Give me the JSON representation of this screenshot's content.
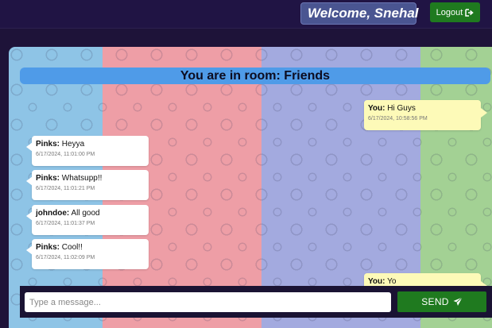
{
  "header": {
    "welcome_text": "Welcome, Snehal",
    "logout_label": "Logout"
  },
  "room": {
    "title": "You are in room: Friends"
  },
  "messages": [
    {
      "sender": "You:",
      "text": "Hi Guys",
      "time": "6/17/2024, 10:58:56 PM",
      "direction": "out"
    },
    {
      "sender": "Pinks:",
      "text": "Heyya",
      "time": "6/17/2024, 11:01:00 PM",
      "direction": "in"
    },
    {
      "sender": "Pinks:",
      "text": "Whatsupp!!",
      "time": "6/17/2024, 11:01:21 PM",
      "direction": "in"
    },
    {
      "sender": "johndoe:",
      "text": "All good",
      "time": "6/17/2024, 11:01:37 PM",
      "direction": "in"
    },
    {
      "sender": "Pinks:",
      "text": "Cool!!",
      "time": "6/17/2024, 11:02:09 PM",
      "direction": "in"
    },
    {
      "sender": "You:",
      "text": "Yo",
      "time": "",
      "direction": "out"
    }
  ],
  "composer": {
    "placeholder": "Type a message...",
    "send_label": "SEND"
  },
  "colors": {
    "background": "#1e1339",
    "accent_green": "#1f7a1f",
    "room_header": "#4f9be8",
    "incoming_bubble": "#ffffff",
    "outgoing_bubble": "#fdfab8",
    "stripes": [
      "#8ec4e6",
      "#ee9ea6",
      "#a3aadf",
      "#a3d194"
    ]
  },
  "icons": {
    "user": "user-icon",
    "logout": "logout-icon",
    "send": "paper-plane-icon"
  }
}
